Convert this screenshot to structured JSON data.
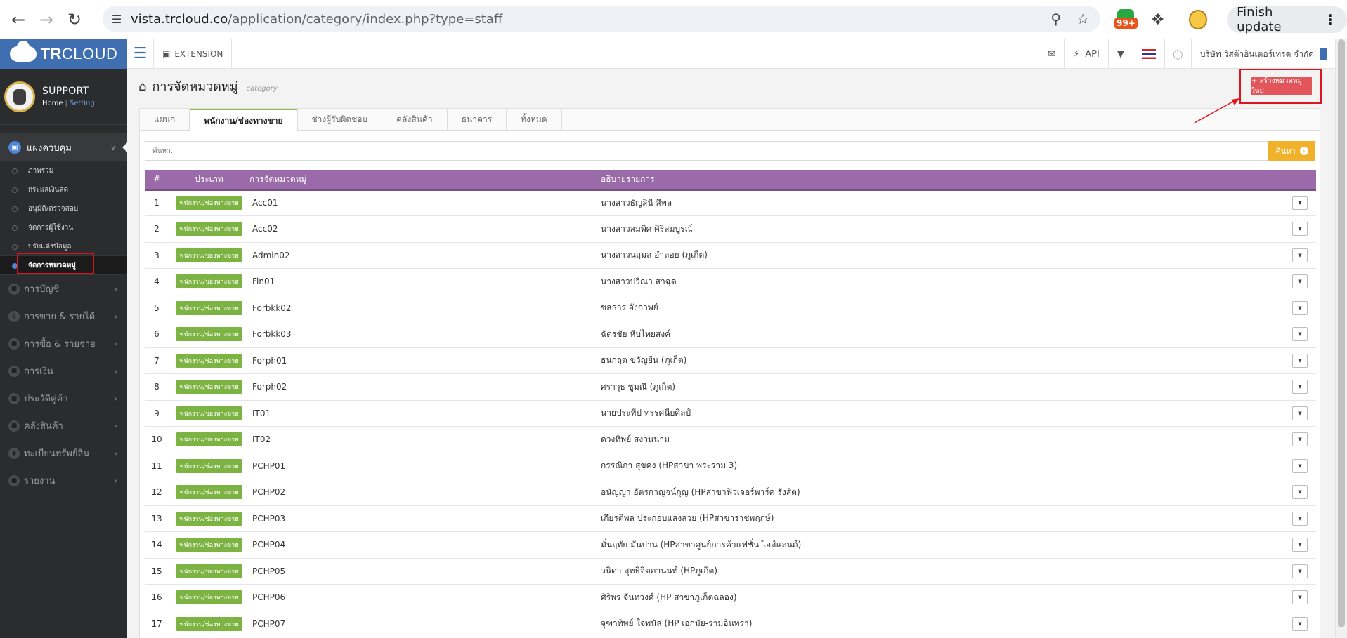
{
  "browser": {
    "url_domain": "vista.trcloud.co",
    "url_path": "/application/category/index.php?type=staff",
    "ext_badge": "99+",
    "finish_update": "Finish update"
  },
  "app": {
    "brand_bold": "TR",
    "brand_thin": "CLOUD",
    "user": {
      "name": "SUPPORT",
      "home": "Home",
      "separator": "|",
      "setting": "Setting"
    },
    "topbar": {
      "extension": "EXTENSION",
      "api": "API",
      "company": "บริษัท วิสต้าอินเตอร์เทรด จำกัด"
    }
  },
  "sidebar": {
    "section": "แผงควบคุม",
    "sub_items": [
      "ภาพรวม",
      "กระแสเงินสด",
      "อนุมัติ/ตรวจสอบ",
      "จัดการผู้ใช้งาน",
      "ปรับแต่งข้อมูล",
      "จัดการหมวดหมู่"
    ],
    "main_items": [
      "การบัญชี",
      "การขาย & รายได้",
      "การซื้อ & รายจ่าย",
      "การเงิน",
      "ประวัติคู่ค้า",
      "คลังสินค้า",
      "ทะเบียนทรัพย์สิน",
      "รายงาน"
    ]
  },
  "page": {
    "title": "การจัดหมวดหมู่",
    "subtitle": "category",
    "create_button": "+ สร้างหมวดหมู่ใหม่",
    "tabs": [
      "แผนก",
      "พนักงาน/ช่องทางขาย",
      "ช่างผู้รับผิดชอบ",
      "คลังสินค้า",
      "ธนาคาร",
      "ทั้งหมด"
    ],
    "active_tab_index": 1,
    "search_placeholder": "ค้นหา..",
    "search_button": "ค้นหา"
  },
  "table": {
    "headers": {
      "num": "#",
      "type": "ประเภท",
      "code": "การจัดหมวดหมู่",
      "desc": "อธิบายรายการ"
    },
    "type_label": "พนักงาน/ช่องทางขาย",
    "rows": [
      {
        "n": "1",
        "code": "Acc01",
        "desc": "นางสาวธัญสินี สีพล"
      },
      {
        "n": "2",
        "code": "Acc02",
        "desc": "นางสาวสมพิศ ศิริสมบูรณ์"
      },
      {
        "n": "3",
        "code": "Admin02",
        "desc": "นางสาวนฤมล อำลอย (ภูเก็ต)"
      },
      {
        "n": "4",
        "code": "Fin01",
        "desc": "นางสาวปวีณา สาฉุด"
      },
      {
        "n": "5",
        "code": "Forbkk02",
        "desc": "ชลธาร อังกาพย์"
      },
      {
        "n": "6",
        "code": "Forbkk03",
        "desc": "ฉัตรชัย หีบไทยสงค์"
      },
      {
        "n": "7",
        "code": "Forph01",
        "desc": "ธนกฤต ขวัญยืน (ภูเก็ต)"
      },
      {
        "n": "8",
        "code": "Forph02",
        "desc": "ศราวุธ ชูมณี (ภูเก็ต)"
      },
      {
        "n": "9",
        "code": "IT01",
        "desc": "นายประทีป ทรรศนียศิลป์"
      },
      {
        "n": "10",
        "code": "IT02",
        "desc": "ดวงทิพย์ สงวนนาม"
      },
      {
        "n": "11",
        "code": "PCHP01",
        "desc": "กรรณิกา สุขคง (HPสาขา พระราม 3)"
      },
      {
        "n": "12",
        "code": "PCHP02",
        "desc": "อนัญญา อัตรกาญจน์กุญ (HPสาขาฟิวเจอร์พาร์ค รังสิต)"
      },
      {
        "n": "13",
        "code": "PCHP03",
        "desc": "เกียรติพล ประกอบแสงสวย (HPสาขาราชพฤกษ์)"
      },
      {
        "n": "14",
        "code": "PCHP04",
        "desc": "มั่นฤทัย มั่นปาน (HPสาขาศูนย์การค้าแฟชั่น ไอส์แลนด์)"
      },
      {
        "n": "15",
        "code": "PCHP05",
        "desc": "วนิดา สุทธิจิตตานนท์ (HPภูเก็ต)"
      },
      {
        "n": "16",
        "code": "PCHP06",
        "desc": "ศิริพร จันทวงศ์ (HP สาขาภูเก็ตฉลอง)"
      },
      {
        "n": "17",
        "code": "PCHP07",
        "desc": "จุฑาทิพย์ ใจพนัส (HP เอกมัย-รามอินทรา)"
      }
    ]
  }
}
